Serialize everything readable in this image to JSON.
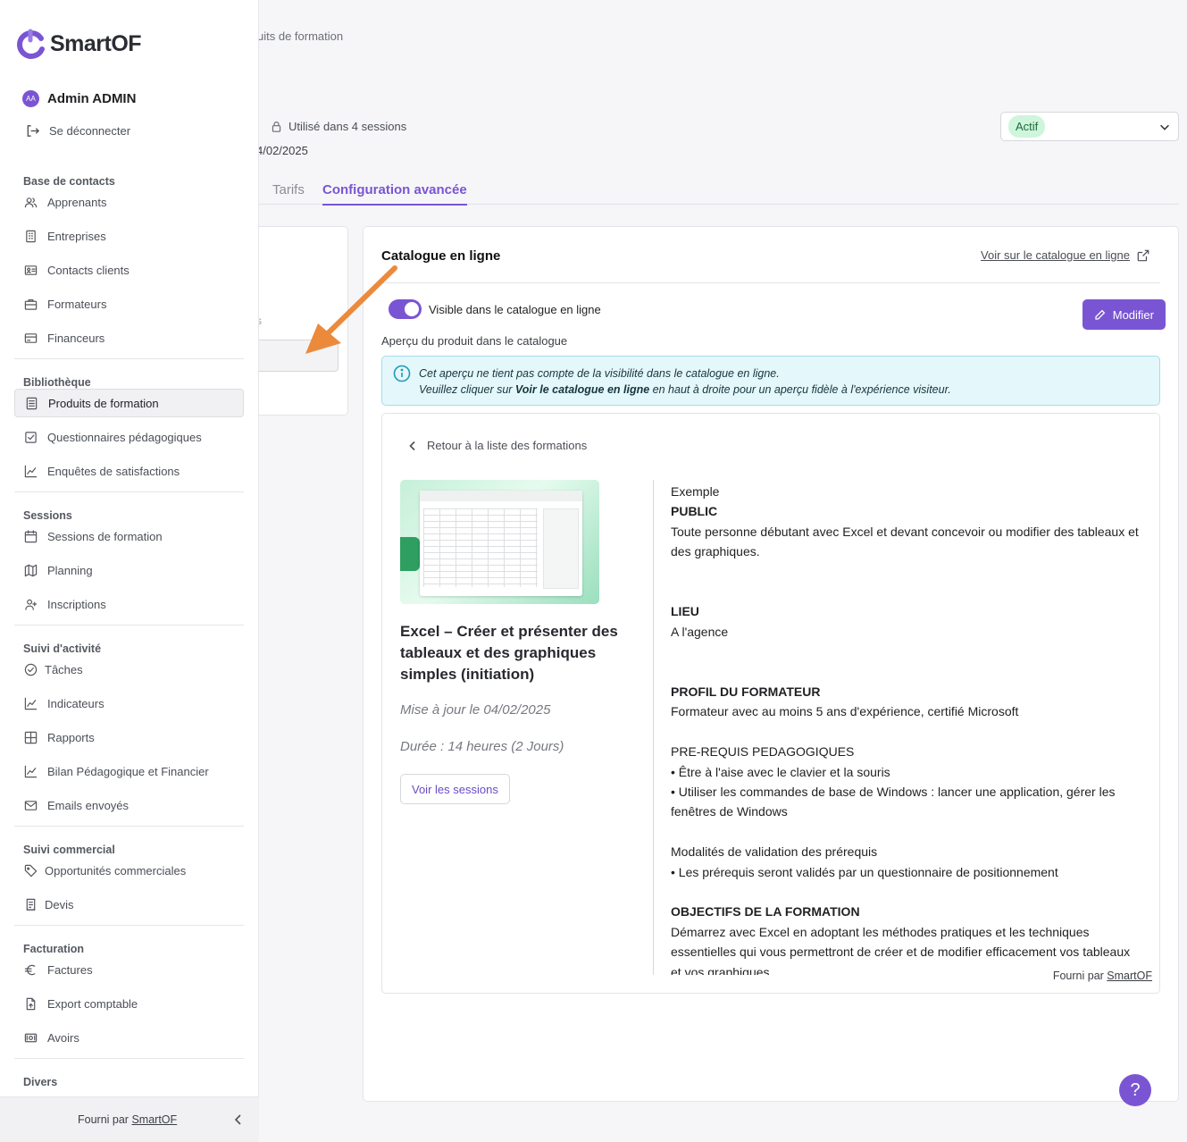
{
  "colors": {
    "accent": "#7a55d3",
    "badge_bg": "#cff5dc",
    "info_bg": "#e4f7fb",
    "arrow": "#ec8a3b"
  },
  "header": {
    "breadcrumb": "uits de formation",
    "usage_text": "Utilisé dans 4 sessions",
    "date_fragment": "4/02/2025",
    "status": {
      "selected": "Actif"
    }
  },
  "tabs": [
    {
      "label": "Tarifs",
      "active": false
    },
    {
      "label": "Configuration avancée",
      "active": true
    }
  ],
  "left_card": {
    "fragment": "s"
  },
  "catalog": {
    "title": "Catalogue en ligne",
    "link_label": "Voir sur le catalogue en ligne",
    "toggle_label": "Visible dans le catalogue en ligne",
    "toggle_on": true,
    "edit_label": "Modifier",
    "preview_label": "Aperçu du produit dans le catalogue",
    "info_line1": "Cet aperçu ne tient pas compte de la visibilité dans le catalogue en ligne.",
    "info_line2_pre": "Veuillez cliquer sur ",
    "info_line2_bold": "Voir le catalogue en ligne",
    "info_line2_post": " en haut à droite pour un aperçu fidèle à l'expérience visiteur."
  },
  "product": {
    "back_label": "Retour à la liste des formations",
    "title": "Excel – Créer et présenter des tableaux et des graphiques simples (initiation)",
    "updated": "Mise à jour le 04/02/2025",
    "duration": "Durée : 14 heures (2 Jours)",
    "sessions_button": "Voir les sessions",
    "description": [
      "Exemple",
      "PUBLIC",
      "Toute personne débutant avec Excel et devant concevoir ou modifier des tableaux et des graphiques.",
      "",
      "",
      "LIEU",
      "A l'agence",
      "",
      "",
      "PROFIL DU FORMATEUR",
      "Formateur avec au moins 5 ans d'expérience, certifié Microsoft",
      "",
      "PRE-REQUIS PEDAGOGIQUES",
      "• Être à l'aise avec le clavier et la souris",
      "• Utiliser les commandes de base de Windows : lancer une application, gérer les fenêtres de Windows",
      "",
      " Modalités de validation des prérequis",
      "• Les prérequis seront validés par un questionnaire de positionnement",
      "",
      "OBJECTIFS DE LA FORMATION",
      "Démarrez avec Excel en adoptant les méthodes pratiques et les techniques essentielles qui vous permettront de créer et de modifier efficacement vos tableaux et vos graphiques."
    ],
    "footer_pre": "Fourni par ",
    "footer_link": "SmartOF"
  },
  "help_label": "?",
  "sidebar": {
    "logo_text": "SmartOF",
    "user": {
      "initials": "AA",
      "name": "Admin ADMIN"
    },
    "logout_label": "Se déconnecter",
    "sections": [
      {
        "title": "Base de contacts",
        "items": [
          {
            "label": "Apprenants",
            "icon": "users-icon"
          },
          {
            "label": "Entreprises",
            "icon": "building-icon"
          },
          {
            "label": "Contacts clients",
            "icon": "contact-card-icon"
          },
          {
            "label": "Formateurs",
            "icon": "briefcase-icon"
          },
          {
            "label": "Financeurs",
            "icon": "credit-card-icon"
          }
        ]
      },
      {
        "title": "Bibliothèque",
        "items": [
          {
            "label": "Produits de formation",
            "icon": "document-list-icon",
            "active": true
          },
          {
            "label": "Questionnaires pédagogiques",
            "icon": "checkbox-icon"
          },
          {
            "label": "Enquêtes de satisfactions",
            "icon": "chart-line-icon"
          }
        ]
      },
      {
        "title": "Sessions",
        "items": [
          {
            "label": "Sessions de formation",
            "icon": "calendar-icon"
          },
          {
            "label": "Planning",
            "icon": "map-icon"
          },
          {
            "label": "Inscriptions",
            "icon": "user-plus-icon"
          }
        ]
      },
      {
        "title": "Suivi d'activité",
        "items": [
          {
            "label": "Tâches",
            "icon": "check-circle-icon"
          },
          {
            "label": "Indicateurs",
            "icon": "chart-line-icon"
          },
          {
            "label": "Rapports",
            "icon": "table-icon"
          },
          {
            "label": "Bilan Pédagogique et Financier",
            "icon": "chart-line-icon"
          },
          {
            "label": "Emails envoyés",
            "icon": "mail-icon"
          }
        ]
      },
      {
        "title": "Suivi commercial",
        "items": [
          {
            "label": "Opportunités commerciales",
            "icon": "tag-icon"
          },
          {
            "label": "Devis",
            "icon": "receipt-icon"
          }
        ]
      },
      {
        "title": "Facturation",
        "items": [
          {
            "label": "Factures",
            "icon": "euro-icon"
          },
          {
            "label": "Export comptable",
            "icon": "file-export-icon"
          },
          {
            "label": "Avoirs",
            "icon": "banknote-icon"
          }
        ]
      },
      {
        "title": "Divers",
        "items": []
      }
    ],
    "footer_pre": "Fourni par ",
    "footer_link": "SmartOF"
  }
}
